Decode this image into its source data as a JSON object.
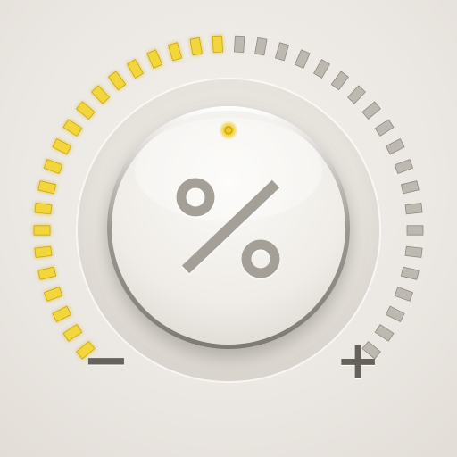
{
  "control": {
    "knob_icon": "percent-icon",
    "level": 0.5,
    "segment_count": 40,
    "decrease_symbol": "−",
    "increase_symbol": "+"
  },
  "colors": {
    "active_segment": "#f3d63a",
    "inactive_segment": "#bdb8b0",
    "glyph": "#a5a097",
    "indicator_led": "#e9c31f",
    "background": "#ece8e3"
  }
}
